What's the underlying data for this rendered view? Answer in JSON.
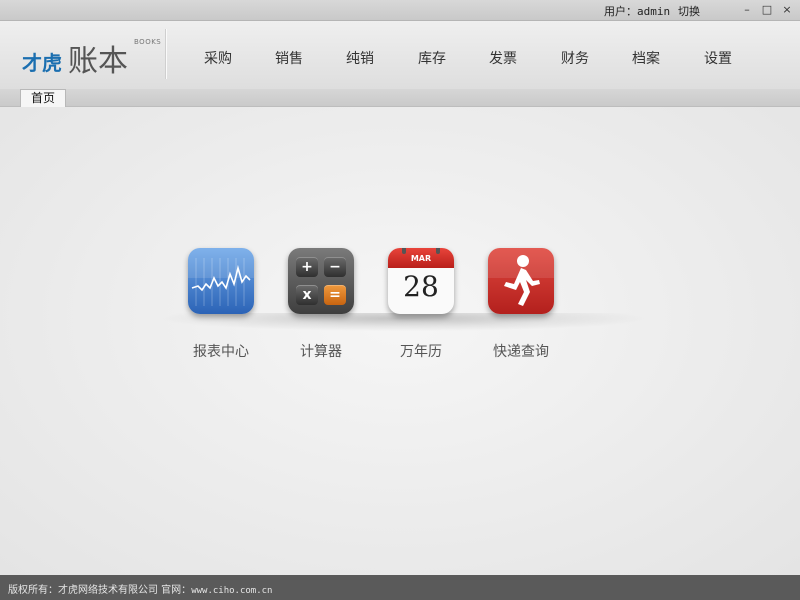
{
  "topbar": {
    "user_label": "用户：",
    "user_name": "admin",
    "switch_label": "切换",
    "min_symbol": "–",
    "max_symbol": "□",
    "close_symbol": "×"
  },
  "logo": {
    "brand": "才虎",
    "title": "账本",
    "sub": "BOOKS"
  },
  "nav": {
    "items": [
      "采购",
      "销售",
      "纯销",
      "库存",
      "发票",
      "财务",
      "档案",
      "设置"
    ]
  },
  "tabs": [
    "首页"
  ],
  "tiles": [
    {
      "label": "报表中心",
      "icon": "chart-icon"
    },
    {
      "label": "计算器",
      "icon": "calculator-icon"
    },
    {
      "label": "万年历",
      "icon": "calendar-icon"
    },
    {
      "label": "快递查询",
      "icon": "runner-icon"
    }
  ],
  "calendar": {
    "month": "MAR",
    "day": "28"
  },
  "calculator": {
    "keys": [
      "+",
      "−",
      "x",
      "="
    ]
  },
  "footer": {
    "copyright": "版权所有：才虎网络技术有限公司  官网：",
    "site": "www.ciho.com.cn"
  },
  "colors": {
    "brand_blue": "#1b6fb0",
    "report_blue": "#2c63b6",
    "calendar_red": "#b91f1a",
    "express_red": "#b3201d",
    "footer": "#5a5a5a"
  }
}
